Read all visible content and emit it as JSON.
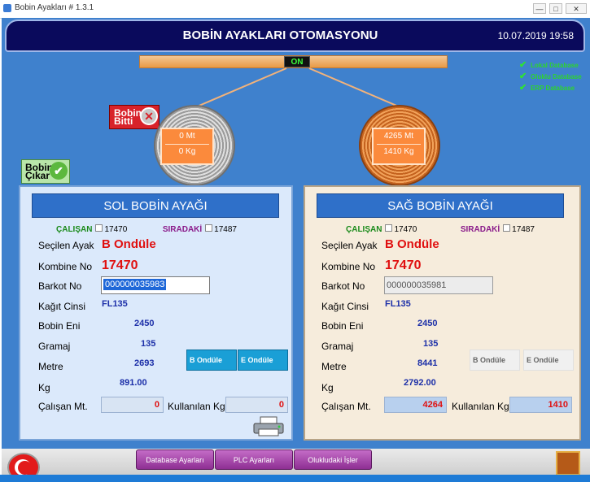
{
  "window": {
    "title": "Bobin Ayakları # 1.3.1",
    "min": "—",
    "max": "□",
    "close": "✕"
  },
  "header": {
    "title": "BOBİN AYAKLARI OTOMASYONU",
    "datetime": "10.07.2019 19:58"
  },
  "status_badge": "ON",
  "databases": [
    {
      "label": "Lokal Database",
      "ok": true
    },
    {
      "label": "Oluklu Database",
      "ok": true
    },
    {
      "label": "ERP Database",
      "ok": true
    }
  ],
  "actions": {
    "bobin_bitti": [
      "Bobin",
      "Bitti"
    ],
    "bobin_cikar": [
      "Bobin",
      "Çıkar"
    ]
  },
  "coils": {
    "left": {
      "mt": "0 Mt",
      "kg": "0 Kg"
    },
    "right": {
      "mt": "4265 Mt",
      "kg": "1410 Kg"
    }
  },
  "labels": {
    "calisan": "ÇALIŞAN",
    "siradaki": "SIRADAKİ",
    "secilen_ayak": "Seçilen Ayak",
    "kombine_no": "Kombine No",
    "barkot_no": "Barkot No",
    "kagit_cinsi": "Kağıt Cinsi",
    "bobin_eni": "Bobin Eni",
    "gramaj": "Gramaj",
    "metre": "Metre",
    "kg": "Kg",
    "calisan_mt": "Çalışan Mt.",
    "kullanilan_kg": "Kullanılan Kg"
  },
  "left": {
    "title": "SOL BOBİN AYAĞI",
    "calisan_no": "17470",
    "siradaki_no": "17487",
    "secilen_ayak": "B Ondüle",
    "kombine_no": "17470",
    "barkot_no": "000000035983",
    "kagit_cinsi": "FL135",
    "bobin_eni": "2450",
    "gramaj": "135",
    "metre": "2693",
    "kg": "891.00",
    "calisan_mt": "0",
    "kullanilan_kg": "0",
    "btn_b": "B Ondüle",
    "btn_e": "E Ondüle"
  },
  "right": {
    "title": "SAĞ BOBİN AYAĞI",
    "calisan_no": "17470",
    "siradaki_no": "17487",
    "secilen_ayak": "B Ondüle",
    "kombine_no": "17470",
    "barkot_no": "000000035981",
    "kagit_cinsi": "FL135",
    "bobin_eni": "2450",
    "gramaj": "135",
    "metre": "8441",
    "kg": "2792.00",
    "calisan_mt": "4264",
    "kullanilan_kg": "1410",
    "btn_b": "B Ondüle",
    "btn_e": "E Ondüle"
  },
  "bottom": {
    "database_ayarlari": "Database Ayarları",
    "plc_ayarlari": "PLC Ayarları",
    "oluklu_isler": "Olukludaki İşler"
  },
  "icons": [
    "app-icon",
    "check-icon",
    "close-icon",
    "printer-icon",
    "flag-icon",
    "exit-door-icon"
  ]
}
